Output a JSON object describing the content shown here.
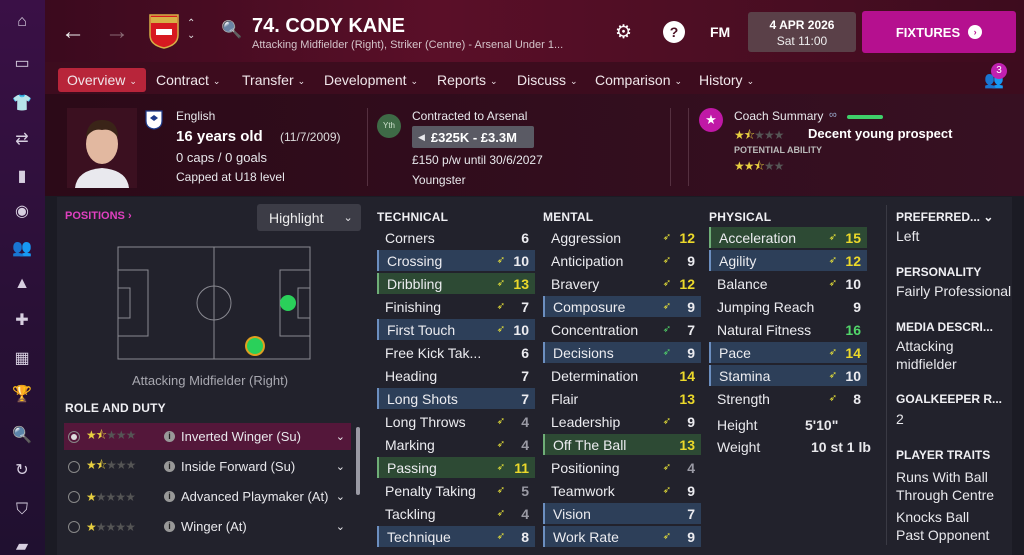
{
  "header": {
    "player_title": "74. CODY KANE",
    "player_subtitle": "Attacking Midfielder (Right), Striker (Centre) - Arsenal Under 1...",
    "club_name": "Arsenal",
    "date": "4 APR 2026",
    "time": "Sat 11:00",
    "fm_label": "FM",
    "fixtures_label": "FIXTURES",
    "notifications": "3"
  },
  "tabs": [
    {
      "label": "Overview"
    },
    {
      "label": "Contract"
    },
    {
      "label": "Transfer"
    },
    {
      "label": "Development"
    },
    {
      "label": "Reports"
    },
    {
      "label": "Discuss"
    },
    {
      "label": "Comparison"
    },
    {
      "label": "History"
    }
  ],
  "profile": {
    "nationality": "English",
    "age": "16 years old",
    "dob": "(11/7/2009)",
    "caps": "0 caps / 0 goals",
    "capped_level": "Capped at U18 level"
  },
  "contract": {
    "yth_label": "Yth",
    "contracted_to": "Contracted to Arsenal",
    "value": "£325K - £3.3M",
    "wage": "£150 p/w until 30/6/2027",
    "status": "Youngster"
  },
  "coach": {
    "summary_label": "Coach Summary",
    "verdict": "Decent young prospect",
    "potential_label": "POTENTIAL ABILITY",
    "current_stars": 1.5,
    "potential_stars": 2.5
  },
  "positions": {
    "label": "POSITIONS",
    "highlight_label": "Highlight",
    "position_name": "Attacking Midfielder (Right)"
  },
  "role_duty": {
    "title": "ROLE AND DUTY",
    "roles": [
      {
        "name": "Inverted Winger (Su)",
        "stars": 1.5,
        "selected": true
      },
      {
        "name": "Inside Forward (Su)",
        "stars": 1.5,
        "selected": false
      },
      {
        "name": "Advanced Playmaker (At)",
        "stars": 1,
        "selected": false
      },
      {
        "name": "Winger (At)",
        "stars": 1,
        "selected": false
      }
    ]
  },
  "technical": {
    "title": "TECHNICAL",
    "attrs": [
      {
        "name": "Corners",
        "value": "6",
        "hl": "",
        "arrow": ""
      },
      {
        "name": "Crossing",
        "value": "10",
        "hl": "blue",
        "arrow": "up"
      },
      {
        "name": "Dribbling",
        "value": "13",
        "hl": "green",
        "arrow": "up"
      },
      {
        "name": "Finishing",
        "value": "7",
        "hl": "",
        "arrow": "up"
      },
      {
        "name": "First Touch",
        "value": "10",
        "hl": "blue",
        "arrow": "up"
      },
      {
        "name": "Free Kick Tak...",
        "value": "6",
        "hl": "",
        "arrow": ""
      },
      {
        "name": "Heading",
        "value": "7",
        "hl": "",
        "arrow": ""
      },
      {
        "name": "Long Shots",
        "value": "7",
        "hl": "blue",
        "arrow": ""
      },
      {
        "name": "Long Throws",
        "value": "4",
        "hl": "",
        "arrow": "up"
      },
      {
        "name": "Marking",
        "value": "4",
        "hl": "",
        "arrow": "up"
      },
      {
        "name": "Passing",
        "value": "11",
        "hl": "green",
        "arrow": "up"
      },
      {
        "name": "Penalty Taking",
        "value": "5",
        "hl": "",
        "arrow": "up"
      },
      {
        "name": "Tackling",
        "value": "4",
        "hl": "",
        "arrow": "up"
      },
      {
        "name": "Technique",
        "value": "8",
        "hl": "blue",
        "arrow": "up"
      }
    ]
  },
  "mental": {
    "title": "MENTAL",
    "attrs": [
      {
        "name": "Aggression",
        "value": "12",
        "hl": "",
        "arrow": "up"
      },
      {
        "name": "Anticipation",
        "value": "9",
        "hl": "",
        "arrow": "up"
      },
      {
        "name": "Bravery",
        "value": "12",
        "hl": "",
        "arrow": "up"
      },
      {
        "name": "Composure",
        "value": "9",
        "hl": "blue",
        "arrow": "up"
      },
      {
        "name": "Concentration",
        "value": "7",
        "hl": "",
        "arrow": "upg"
      },
      {
        "name": "Decisions",
        "value": "9",
        "hl": "blue",
        "arrow": "upg"
      },
      {
        "name": "Determination",
        "value": "14",
        "hl": "",
        "arrow": ""
      },
      {
        "name": "Flair",
        "value": "13",
        "hl": "",
        "arrow": ""
      },
      {
        "name": "Leadership",
        "value": "9",
        "hl": "",
        "arrow": "up"
      },
      {
        "name": "Off The Ball",
        "value": "13",
        "hl": "green",
        "arrow": ""
      },
      {
        "name": "Positioning",
        "value": "4",
        "hl": "",
        "arrow": "up"
      },
      {
        "name": "Teamwork",
        "value": "9",
        "hl": "",
        "arrow": "up"
      },
      {
        "name": "Vision",
        "value": "7",
        "hl": "blue",
        "arrow": ""
      },
      {
        "name": "Work Rate",
        "value": "9",
        "hl": "blue",
        "arrow": "up"
      }
    ]
  },
  "physical": {
    "title": "PHYSICAL",
    "attrs": [
      {
        "name": "Acceleration",
        "value": "15",
        "hl": "green",
        "arrow": "up"
      },
      {
        "name": "Agility",
        "value": "12",
        "hl": "blue",
        "arrow": "up"
      },
      {
        "name": "Balance",
        "value": "10",
        "hl": "",
        "arrow": "up"
      },
      {
        "name": "Jumping Reach",
        "value": "9",
        "hl": "",
        "arrow": ""
      },
      {
        "name": "Natural Fitness",
        "value": "16",
        "hl": "",
        "arrow": ""
      },
      {
        "name": "Pace",
        "value": "14",
        "hl": "blue",
        "arrow": "up"
      },
      {
        "name": "Stamina",
        "value": "10",
        "hl": "blue",
        "arrow": "up"
      },
      {
        "name": "Strength",
        "value": "8",
        "hl": "",
        "arrow": "up"
      }
    ],
    "height_label": "Height",
    "height": "5'10\"",
    "weight_label": "Weight",
    "weight": "10 st 1 lb"
  },
  "side": {
    "preferred_label": "PREFERRED...",
    "preferred_value": "Left",
    "personality_label": "PERSONALITY",
    "personality_value": "Fairly Professional",
    "media_label": "MEDIA DESCRI...",
    "media_value_1": "Attacking",
    "media_value_2": "midfielder",
    "gk_label": "GOALKEEPER R...",
    "gk_value": "2",
    "traits_label": "PLAYER TRAITS",
    "trait1_line1": "Runs With Ball",
    "trait1_line2": "Through Centre",
    "trait2_line1": "Knocks Ball",
    "trait2_line2": "Past Opponent"
  },
  "colors": {
    "accent": "#b8253a",
    "fixtures": "#b5108f",
    "highlight_value": "#ecd92a",
    "good_value": "#52d66a"
  }
}
